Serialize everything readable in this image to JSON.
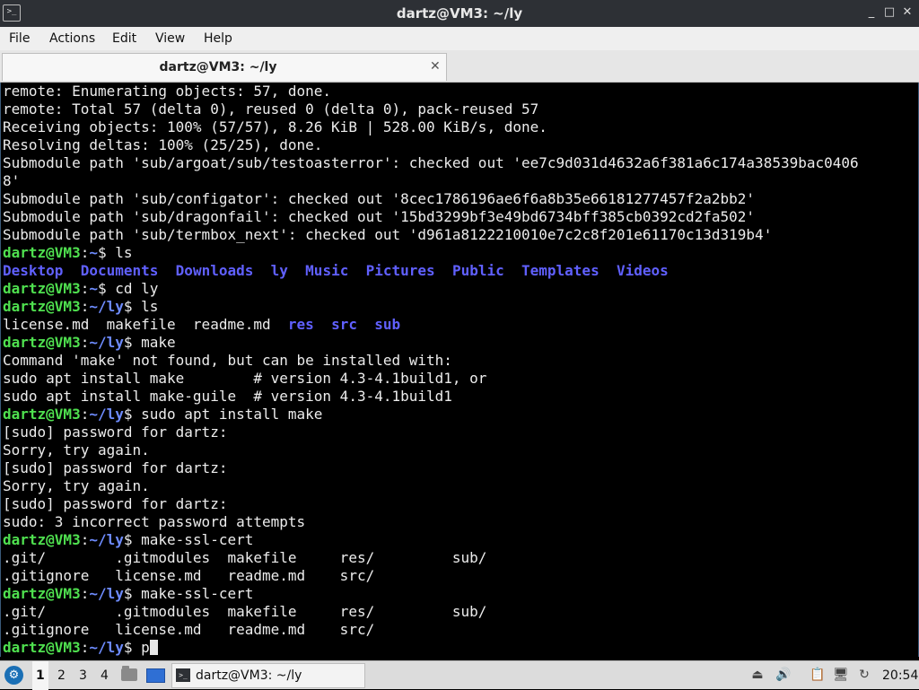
{
  "window": {
    "title": "dartz@VM3: ~/ly",
    "app_icon_glyph": ">_",
    "controls": {
      "minimize": "_",
      "maximize": "□",
      "close": "✕"
    }
  },
  "menu": [
    "File",
    "Actions",
    "Edit",
    "View",
    "Help"
  ],
  "tab": {
    "label": "dartz@VM3: ~/ly",
    "close": "✕"
  },
  "terminal": {
    "prompt_user": "dartz@VM3",
    "lines": [
      "remote: Enumerating objects: 57, done.",
      "remote: Total 57 (delta 0), reused 0 (delta 0), pack-reused 57",
      "Receiving objects: 100% (57/57), 8.26 KiB | 528.00 KiB/s, done.",
      "Resolving deltas: 100% (25/25), done.",
      "Submodule path 'sub/argoat/sub/testoasterror': checked out 'ee7c9d031d4632a6f381a6c174a38539bac0406",
      "8'",
      "Submodule path 'sub/configator': checked out '8cec1786196ae6f6a8b35e66181277457f2a2bb2'",
      "Submodule path 'sub/dragonfail': checked out '15bd3299bf3e49bd6734bff385cb0392cd2fa502'",
      "Submodule path 'sub/termbox_next': checked out 'd961a8122210010e7c2c8f201e61170c13d319b4'",
      "dartz@VM3:~$ ls",
      "Desktop  Documents  Downloads  ly  Music  Pictures  Public  Templates  Videos",
      "dartz@VM3:~$ cd ly",
      "dartz@VM3:~/ly$ ls",
      "license.md  makefile  readme.md  res  src  sub",
      "dartz@VM3:~/ly$ make",
      "Command 'make' not found, but can be installed with:",
      "sudo apt install make        # version 4.3-4.1build1, or",
      "sudo apt install make-guile  # version 4.3-4.1build1",
      "dartz@VM3:~/ly$ sudo apt install make",
      "[sudo] password for dartz:",
      "Sorry, try again.",
      "[sudo] password for dartz:",
      "Sorry, try again.",
      "[sudo] password for dartz:",
      "sudo: 3 incorrect password attempts",
      "dartz@VM3:~/ly$ make-ssl-cert",
      ".git/        .gitmodules  makefile     res/         sub/",
      ".gitignore   license.md   readme.md    src/",
      "dartz@VM3:~/ly$ make-ssl-cert",
      ".git/        .gitmodules  makefile     res/         sub/",
      ".gitignore   license.md   readme.md    src/",
      "dartz@VM3:~/ly$ p"
    ]
  },
  "taskbar": {
    "main_menu_icon": "start-menu-icon",
    "workspaces": [
      "1",
      "2",
      "3",
      "4"
    ],
    "active_workspace": "1",
    "task_label": "dartz@VM3: ~/ly",
    "tray_icons": [
      "eject-icon",
      "volume-icon",
      "clipboard-icon",
      "network-icon",
      "update-icon"
    ],
    "clock": "20:54"
  },
  "colors": {
    "prompt": "#4fe04f",
    "path": "#6e8cff",
    "directory": "#6060ff",
    "terminal_text": "#ececec",
    "terminal_bg": "#000000",
    "titlebar_bg": "#2d3035"
  }
}
